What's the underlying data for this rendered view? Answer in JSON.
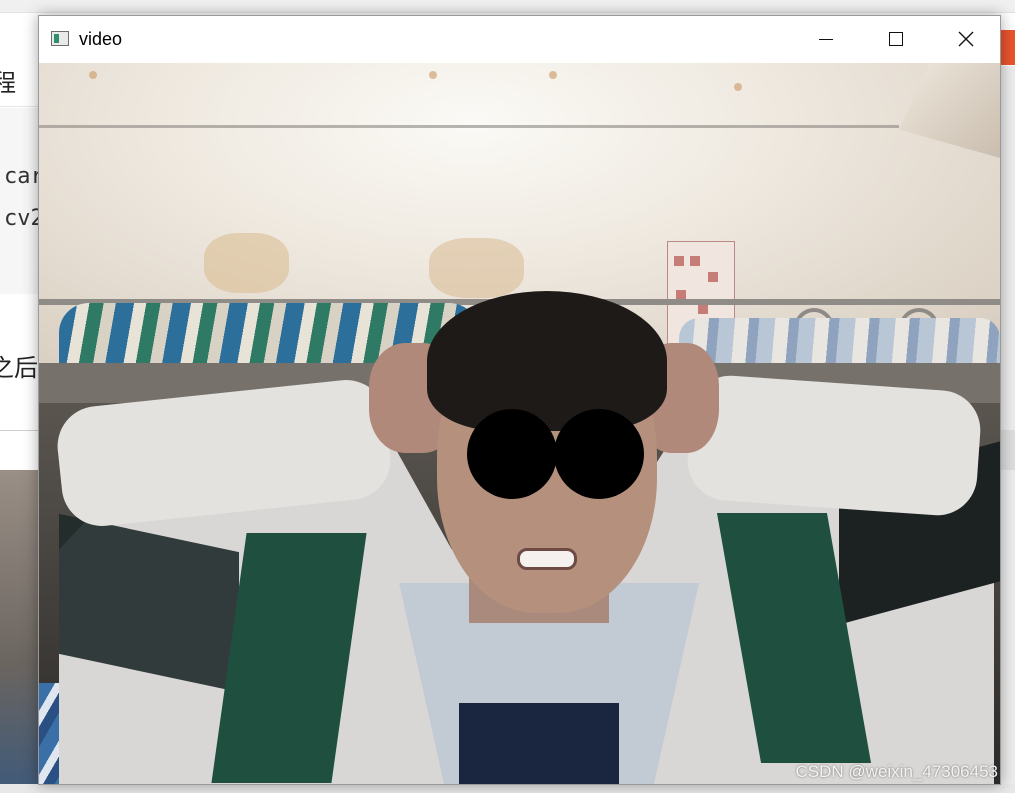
{
  "background_page": {
    "fragment_title": "程",
    "code_lines": [
      "car",
      "cv2"
    ],
    "paragraph_fragment": "之后"
  },
  "window": {
    "title": "video",
    "icon": "window-app-icon",
    "controls": {
      "minimize_icon": "minimize-icon",
      "maximize_icon": "maximize-icon",
      "close_icon": "close-icon"
    }
  },
  "video": {
    "watermark": "CSDN @weixin_47306453"
  }
}
